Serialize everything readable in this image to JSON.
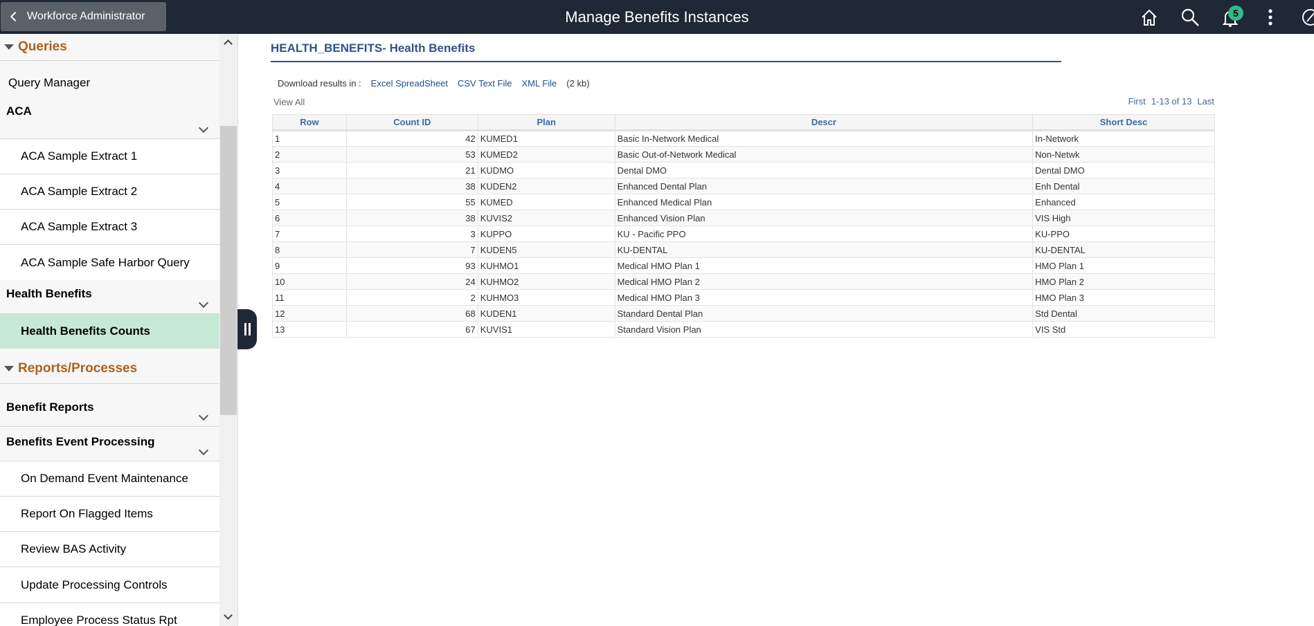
{
  "header": {
    "back_label": "Workforce Administrator",
    "title": "Manage Benefits Instances",
    "notification_count": "5"
  },
  "sidebar": {
    "queries": "Queries",
    "query_manager": "Query Manager",
    "aca": "ACA",
    "aca_items": [
      "ACA Sample Extract 1",
      "ACA Sample Extract 2",
      "ACA Sample Extract 3",
      "ACA Sample Safe Harbor Query"
    ],
    "health_benefits": "Health Benefits",
    "health_counts": "Health Benefits Counts",
    "reports": "Reports/Processes",
    "benefit_reports": "Benefit Reports",
    "bep": "Benefits Event Processing",
    "bep_items": [
      "On Demand Event Maintenance",
      "Report On Flagged Items",
      "Review BAS Activity",
      "Update Processing Controls",
      "Employee Process Status Rpt"
    ]
  },
  "content": {
    "title": "HEALTH_BENEFITS- Health Benefits",
    "download_label": "Download results in :",
    "excel": "Excel SpreadSheet",
    "csv": "CSV Text File",
    "xml": "XML File",
    "size": "(2 kb)",
    "view_all": "View All",
    "pager": {
      "first": "First",
      "range": "1-13 of 13",
      "last": "Last"
    },
    "columns": [
      "Row",
      "Count ID",
      "Plan",
      "Descr",
      "Short Desc"
    ],
    "rows": [
      [
        "1",
        "42",
        "KUMED1",
        "Basic In-Network Medical",
        "In-Network"
      ],
      [
        "2",
        "53",
        "KUMED2",
        "Basic Out-of-Network Medical",
        "Non-Netwk"
      ],
      [
        "3",
        "21",
        "KUDMO",
        "Dental DMO",
        "Dental DMO"
      ],
      [
        "4",
        "38",
        "KUDEN2",
        "Enhanced Dental Plan",
        "Enh Dental"
      ],
      [
        "5",
        "55",
        "KUMED",
        "Enhanced Medical Plan",
        "Enhanced"
      ],
      [
        "6",
        "38",
        "KUVIS2",
        "Enhanced Vision Plan",
        "VIS High"
      ],
      [
        "7",
        "3",
        "KUPPO",
        "KU - Pacific PPO",
        "KU-PPO"
      ],
      [
        "8",
        "7",
        "KUDEN5",
        "KU-DENTAL",
        "KU-DENTAL"
      ],
      [
        "9",
        "93",
        "KUHMO1",
        "Medical HMO Plan 1",
        "HMO Plan 1"
      ],
      [
        "10",
        "24",
        "KUHMO2",
        "Medical HMO Plan 2",
        "HMO Plan 2"
      ],
      [
        "11",
        "2",
        "KUHMO3",
        "Medical HMO Plan 3",
        "HMO Plan 3"
      ],
      [
        "12",
        "68",
        "KUDEN1",
        "Standard Dental Plan",
        "Std Dental"
      ],
      [
        "13",
        "67",
        "KUVIS1",
        "Standard Vision Plan",
        "VIS Std"
      ]
    ]
  }
}
